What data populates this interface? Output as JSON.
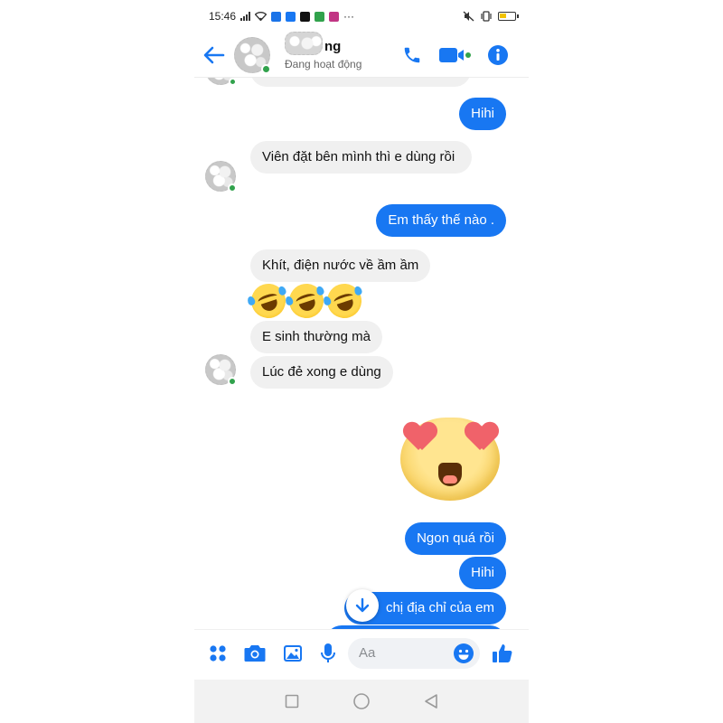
{
  "status_bar": {
    "time": "15:46",
    "more": "···",
    "app_icon_colors": [
      "#1a73e8",
      "#1877f2",
      "#111111",
      "#31a24c",
      "#c13584"
    ]
  },
  "header": {
    "contact_name_suffix": "ng",
    "contact_status": "Đang hoạt động"
  },
  "messages": [
    {
      "side": "out",
      "text": "Hihi"
    },
    {
      "side": "in",
      "text": "Viên đặt bên mình thì e dùng rồi"
    },
    {
      "side": "out",
      "text": "Em thấy thế nào ."
    },
    {
      "side": "in",
      "text": "Khít, điện nước về ầm ầm"
    },
    {
      "side": "in",
      "text": "🤣🤣🤣"
    },
    {
      "side": "in",
      "text": "E sinh thường mà"
    },
    {
      "side": "in",
      "text": "Lúc đẻ xong e dùng"
    },
    {
      "side": "out",
      "text": "Ngon quá rồi"
    },
    {
      "side": "out",
      "text": "Hihi"
    },
    {
      "side": "out",
      "text": "chị địa chỉ của em"
    }
  ],
  "composer": {
    "placeholder": "Aa"
  },
  "colors": {
    "accent": "#1877f2",
    "incoming_bubble": "#f0f0f0",
    "online": "#31a24c"
  }
}
